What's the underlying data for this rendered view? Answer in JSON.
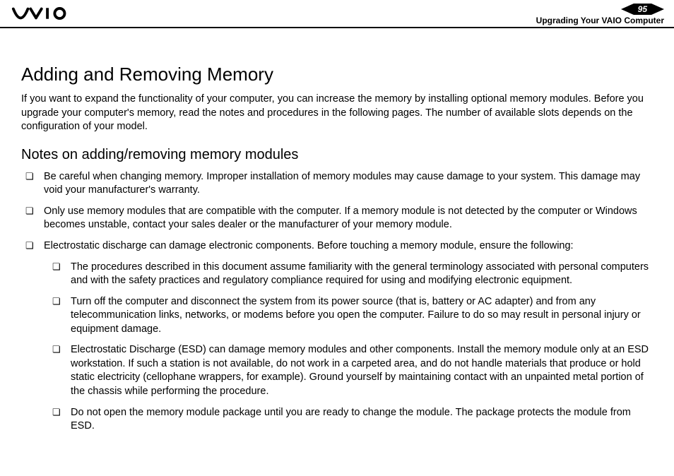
{
  "header": {
    "page_number": "95",
    "section": "Upgrading Your VAIO Computer"
  },
  "content": {
    "h1": "Adding and Removing Memory",
    "intro": "If you want to expand the functionality of your computer, you can increase the memory by installing optional memory modules. Before you upgrade your computer's memory, read the notes and procedures in the following pages. The number of available slots depends on the configuration of your model.",
    "h2": "Notes on adding/removing memory modules",
    "bullets": [
      "Be careful when changing memory. Improper installation of memory modules may cause damage to your system. This damage may void your manufacturer's warranty.",
      "Only use memory modules that are compatible with the computer. If a memory module is not detected by the computer or Windows becomes unstable, contact your sales dealer or the manufacturer of your memory module.",
      "Electrostatic discharge can damage electronic components. Before touching a memory module, ensure the following:"
    ],
    "sub_bullets": [
      "The procedures described in this document assume familiarity with the general terminology associated with personal computers and with the safety practices and regulatory compliance required for using and modifying electronic equipment.",
      "Turn off the computer and disconnect the system from its power source (that is, battery or AC adapter) and from any telecommunication links, networks, or modems before you open the computer. Failure to do so may result in personal injury or equipment damage.",
      "Electrostatic Discharge (ESD) can damage memory modules and other components. Install the memory module only at an ESD workstation. If such a station is not available, do not work in a carpeted area, and do not handle materials that produce or hold static electricity (cellophane wrappers, for example). Ground yourself by maintaining contact with an unpainted metal portion of the chassis while performing the procedure.",
      "Do not open the memory module package until you are ready to change the module. The package protects the module from ESD."
    ]
  }
}
